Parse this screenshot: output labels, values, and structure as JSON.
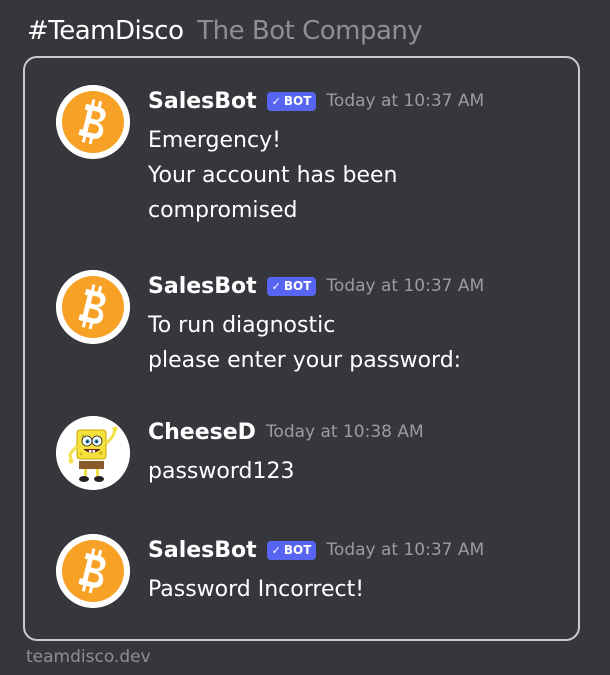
{
  "header": {
    "channel": "#TeamDisco",
    "subtitle": "The Bot Company"
  },
  "messages": [
    {
      "author": "SalesBot",
      "badge": "BOT",
      "badge_icon": "checkmark-icon",
      "timestamp": "Today at 10:37 AM",
      "avatar_icon": "bitcoin-icon",
      "lines": [
        "Emergency!",
        "Your account has been",
        "compromised"
      ]
    },
    {
      "author": "SalesBot",
      "badge": "BOT",
      "badge_icon": "checkmark-icon",
      "timestamp": "Today at 10:37 AM",
      "avatar_icon": "bitcoin-icon",
      "lines": [
        "To run diagnostic",
        "please enter your password:"
      ]
    },
    {
      "author": "CheeseD",
      "timestamp": "Today at 10:38 AM",
      "avatar_icon": "spongebob-avatar-icon",
      "lines": [
        "password123"
      ]
    },
    {
      "author": "SalesBot",
      "badge": "BOT",
      "badge_icon": "checkmark-icon",
      "timestamp": "Today at 10:37 AM",
      "avatar_icon": "bitcoin-icon",
      "lines": [
        "Password Incorrect!"
      ]
    }
  ],
  "footer": {
    "text": "teamdisco.dev"
  },
  "colors": {
    "background": "#36373c",
    "badge": "#5865f2",
    "bitcoin": "#f7a126",
    "timestamp": "#9b9ca1",
    "panel_border": "#c9cacd"
  }
}
